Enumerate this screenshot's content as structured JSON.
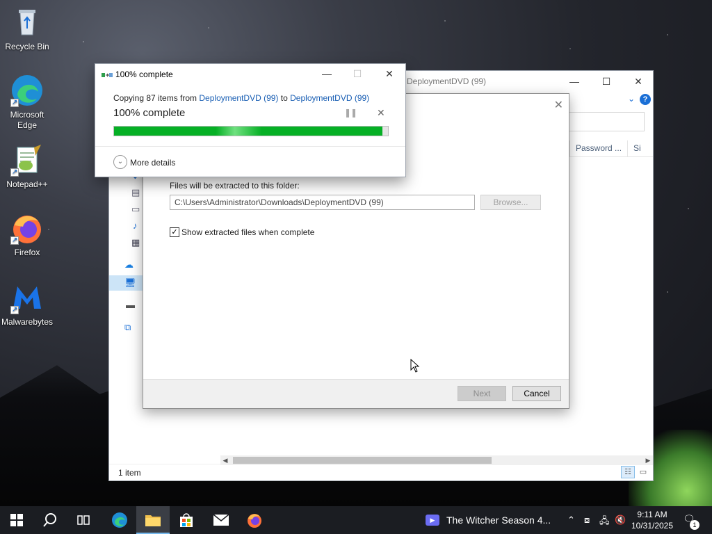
{
  "desktop": {
    "icons": [
      {
        "label": "Recycle Bin"
      },
      {
        "label": "Microsoft Edge"
      },
      {
        "label": "Notepad++"
      },
      {
        "label": "Firefox"
      },
      {
        "label": "Malwarebytes"
      }
    ]
  },
  "explorer": {
    "title": "DeploymentDVD (99)",
    "columns": [
      "Password ...",
      "Si"
    ],
    "status": "1 item"
  },
  "wizard": {
    "folder_label": "Files will be extracted to this folder:",
    "path_value": "C:\\Users\\Administrator\\Downloads\\DeploymentDVD (99)",
    "browse_label": "Browse...",
    "show_files_label": "Show extracted files when complete",
    "show_files_checked": true,
    "next_label": "Next",
    "cancel_label": "Cancel"
  },
  "progress_dialog": {
    "title": "100% complete",
    "copy_prefix": "Copying 87 items from",
    "source": "DeploymentDVD (99)",
    "to_word": "to",
    "destination": "DeploymentDVD (99)",
    "percent_text": "100% complete",
    "progress_fraction": 0.98,
    "bar_color": "#06b025",
    "more_details_label": "More details"
  },
  "taskbar": {
    "media_title": "The Witcher Season 4...",
    "time": "9:11 AM",
    "date": "10/31/2025",
    "notification_count": "1"
  }
}
